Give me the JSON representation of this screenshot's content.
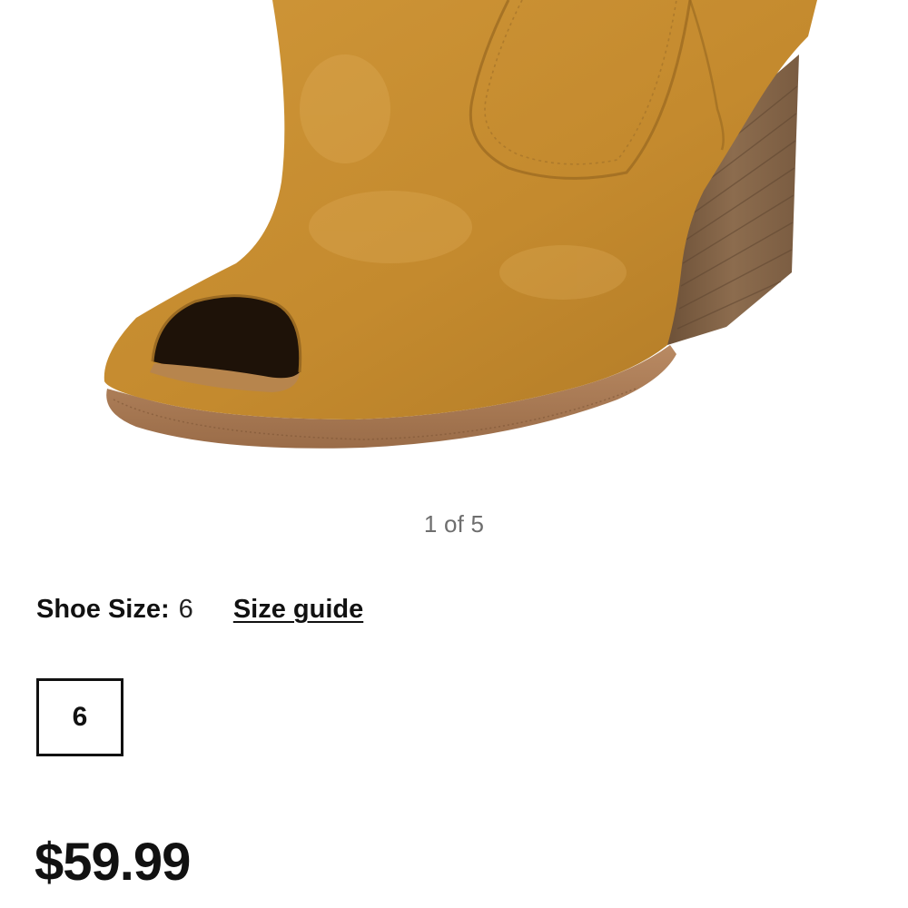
{
  "gallery": {
    "image_subject": "tan suede peep-toe ankle boot with stacked wooden heel",
    "pager_text": "1 of 5",
    "current_index": 1,
    "total_images": 5
  },
  "size_selector": {
    "label": "Shoe Size",
    "colon": ":",
    "selected_value": "6",
    "size_guide_link": "Size guide",
    "options": [
      "6"
    ],
    "selected_option": "6"
  },
  "price": {
    "display": "$59.99"
  },
  "colors": {
    "suede": "#c48a2e",
    "sole": "#a97a55",
    "heel_wood": "#8a6a4c",
    "text_primary": "#111111",
    "text_muted": "#6e6e6e"
  }
}
